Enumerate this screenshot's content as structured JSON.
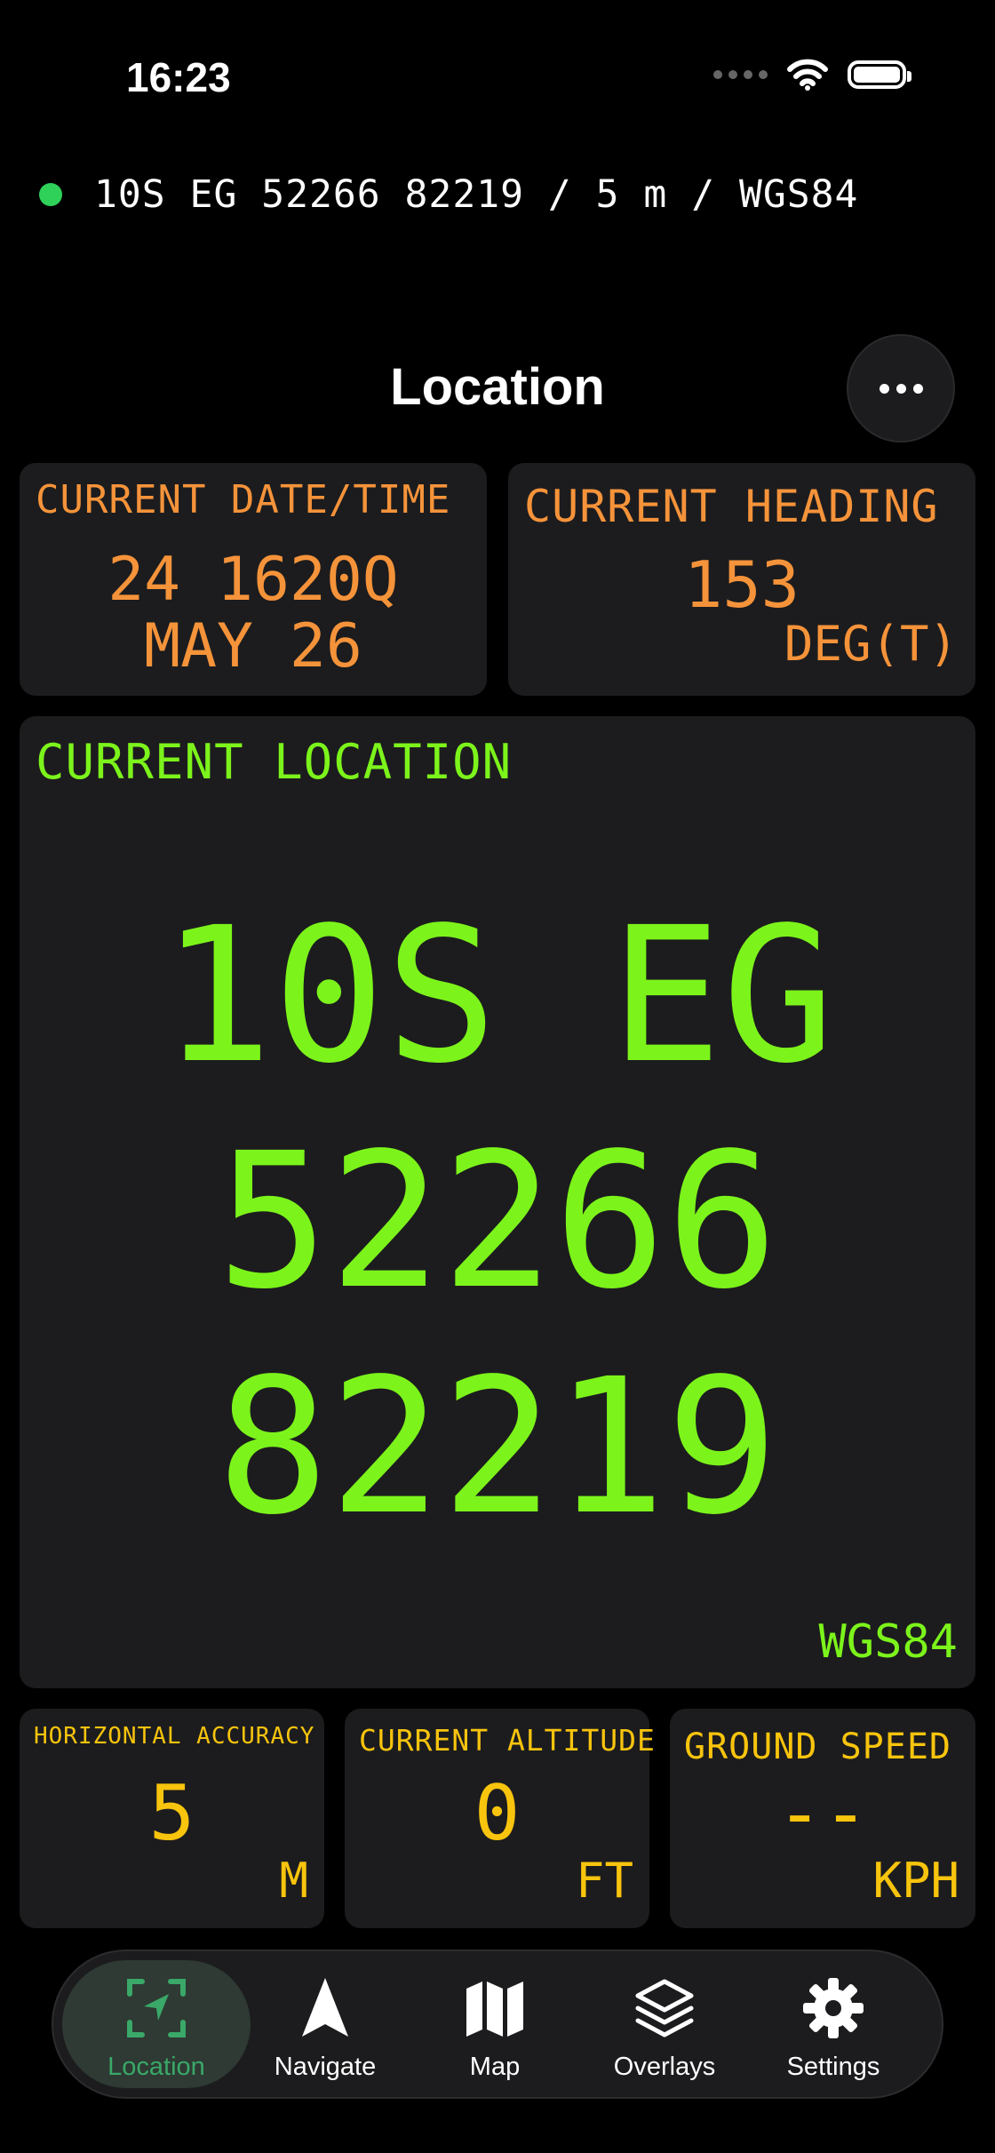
{
  "status_bar": {
    "time": "16:23"
  },
  "position_line": {
    "text": "10S EG 52266 82219 / 5 m / WGS84"
  },
  "header": {
    "title": "Location"
  },
  "datetime_card": {
    "label": "CURRENT DATE/TIME",
    "line1": "24 1620Q",
    "line2": "MAY 26"
  },
  "heading_card": {
    "label": "CURRENT HEADING",
    "value": "153",
    "unit": "DEG(T)"
  },
  "location_card": {
    "label": "CURRENT LOCATION",
    "line1": "10S EG",
    "line2": "52266",
    "line3": "82219",
    "datum": "WGS84"
  },
  "accuracy_card": {
    "label": "HORIZONTAL ACCURACY",
    "value": "5",
    "unit": "M"
  },
  "altitude_card": {
    "label": "CURRENT ALTITUDE",
    "value": "0",
    "unit": "FT"
  },
  "speed_card": {
    "label": "GROUND SPEED",
    "value": "--",
    "unit": "KPH"
  },
  "tabs": [
    {
      "label": "Location",
      "icon": "location-arrow-frame-icon",
      "active": true
    },
    {
      "label": "Navigate",
      "icon": "navigate-arrow-icon",
      "active": false
    },
    {
      "label": "Map",
      "icon": "map-icon",
      "active": false
    },
    {
      "label": "Overlays",
      "icon": "layers-icon",
      "active": false
    },
    {
      "label": "Settings",
      "icon": "gear-icon",
      "active": false
    }
  ],
  "colors": {
    "orange": "#f5933a",
    "green": "#7cf41b",
    "yellow": "#f8c40d",
    "gps_dot": "#2fd158",
    "tab_active": "#3aa868",
    "card_bg": "#1c1c1e"
  }
}
